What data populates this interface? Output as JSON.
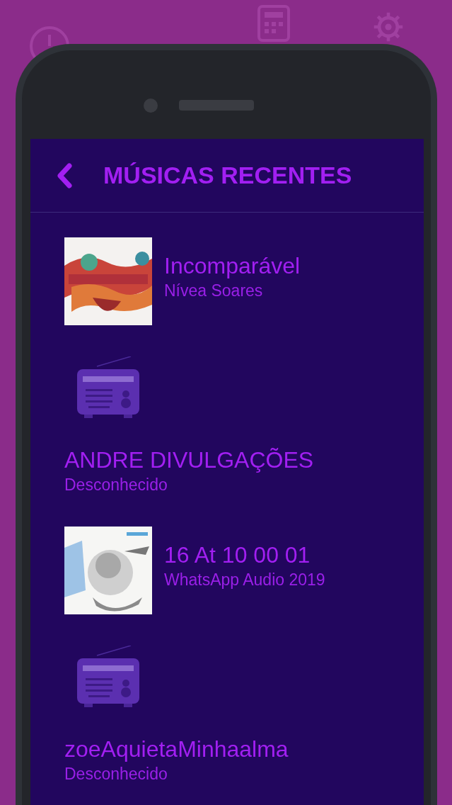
{
  "header": {
    "title": "MÚSICAS RECENTES"
  },
  "items": [
    {
      "kind": "splash",
      "title": "Incomparável",
      "subtitle": "Nívea Soares"
    },
    {
      "kind": "radio",
      "title": "ANDRE DIVULGAÇÕES",
      "subtitle": "Desconhecido"
    },
    {
      "kind": "sketch",
      "title": "16 At 10 00 01",
      "subtitle": "WhatsApp Audio 2019"
    },
    {
      "kind": "radio",
      "title": "zoeAquietaMinhaalma",
      "subtitle": "Desconhecido"
    }
  ]
}
